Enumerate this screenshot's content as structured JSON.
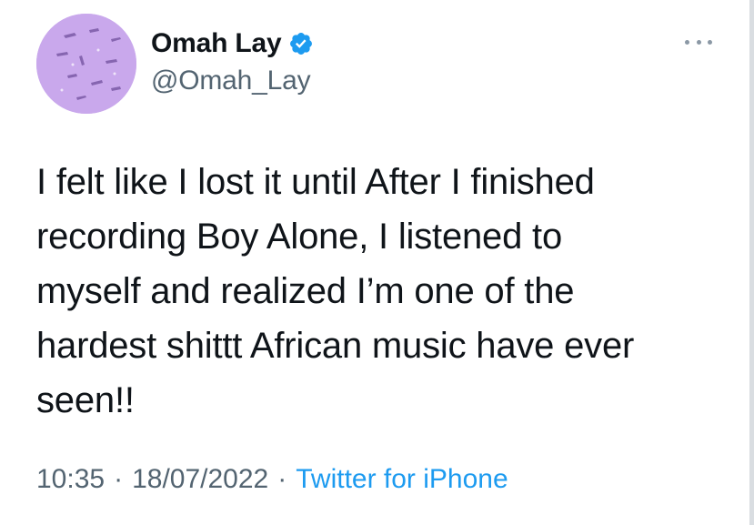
{
  "author": {
    "display_name": "Omah Lay",
    "handle": "@Omah_Lay",
    "verified": true,
    "avatar_icon": "avatar-image",
    "verified_icon": "verified-badge-icon"
  },
  "tweet": {
    "text": "I felt like I lost it until After I finished\nrecording Boy Alone, I listened to\nmyself and realized I’m one of the\nhardest shittt African music have ever\nseen!!"
  },
  "meta": {
    "time": "10:35",
    "date": "18/07/2022",
    "separator": "·",
    "source": "Twitter for iPhone"
  },
  "more_menu_icon": "more-options-icon",
  "colors": {
    "text_primary": "#0f1419",
    "text_secondary": "#536471",
    "accent": "#1d9bf0",
    "avatar_bg": "#c9a8ec"
  }
}
